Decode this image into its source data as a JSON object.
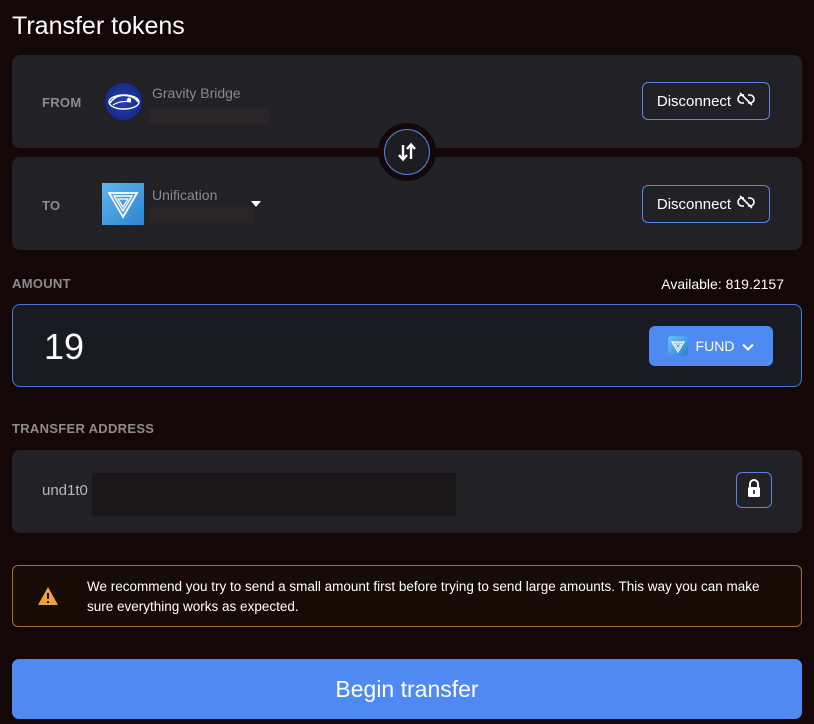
{
  "page": {
    "title": "Transfer tokens"
  },
  "from": {
    "label": "FROM",
    "chain_name": "Gravity Bridge",
    "logo": "gravity-bridge-logo",
    "disconnect_label": "Disconnect",
    "disconnect_icon": "unlink-icon"
  },
  "swap": {
    "icon": "swap-vertical-icon"
  },
  "to": {
    "label": "TO",
    "chain_name": "Unification",
    "logo": "unification-logo",
    "dropdown_icon": "caret-down-icon",
    "disconnect_label": "Disconnect",
    "disconnect_icon": "unlink-icon"
  },
  "amount": {
    "label": "AMOUNT",
    "available": "Available: 819.2157",
    "value": "19",
    "token_label": "FUND",
    "token_icon": "fund-token-icon"
  },
  "address": {
    "label": "TRANSFER ADDRESS",
    "value_prefix": "und1t0",
    "lock_icon": "lock-icon"
  },
  "warning": {
    "icon": "warning-icon",
    "text": "We recommend you try to send a small amount first before trying to send large amounts. This way you can make sure everything works as expected.",
    "border_color": "#a86f2b"
  },
  "submit": {
    "label": "Begin transfer"
  },
  "colors": {
    "background": "#140707",
    "card": "#222125",
    "accent": "#4f8af3",
    "accent_border": "#5b86e5"
  }
}
